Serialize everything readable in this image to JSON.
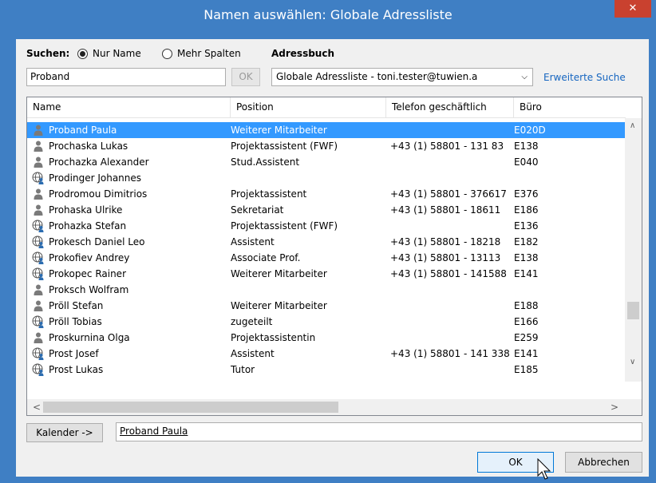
{
  "window": {
    "title": "Namen auswählen: Globale Adressliste",
    "close_glyph": "✕"
  },
  "search": {
    "label": "Suchen:",
    "radio_name_only": "Nur Name",
    "radio_more_columns": "Mehr Spalten",
    "value": "Proband",
    "ok_label": "OK"
  },
  "addressbook": {
    "label": "Adressbuch",
    "selected": "Globale Adressliste - toni.tester@tuwien.a",
    "advanced_search": "Erweiterte Suche"
  },
  "columns": [
    "Name",
    "Position",
    "Telefon geschäftlich",
    "Büro"
  ],
  "rows": [
    {
      "icon": "person",
      "name": "Proband Paula",
      "position": "Weiterer Mitarbeiter",
      "phone": "",
      "office": "E020D",
      "selected": true
    },
    {
      "icon": "person",
      "name": "Prochaska Lukas",
      "position": "Projektassistent (FWF)",
      "phone": "+43 (1) 58801 - 131 83",
      "office": "E138"
    },
    {
      "icon": "person",
      "name": "Prochazka Alexander",
      "position": "Stud.Assistent",
      "phone": "",
      "office": "E040"
    },
    {
      "icon": "globe",
      "name": "Prodinger Johannes",
      "position": "",
      "phone": "",
      "office": ""
    },
    {
      "icon": "person",
      "name": "Prodromou Dimitrios",
      "position": "Projektassistent",
      "phone": "+43 (1) 58801 - 376617",
      "office": "E376"
    },
    {
      "icon": "person",
      "name": "Prohaska Ulrike",
      "position": "Sekretariat",
      "phone": "+43 (1) 58801 - 18611",
      "office": "E186"
    },
    {
      "icon": "globe",
      "name": "Prohazka Stefan",
      "position": "Projektassistent (FWF)",
      "phone": "",
      "office": "E136"
    },
    {
      "icon": "globe",
      "name": "Prokesch Daniel Leo",
      "position": "Assistent",
      "phone": "+43 (1) 58801 - 18218",
      "office": "E182"
    },
    {
      "icon": "globe",
      "name": "Prokofiev Andrey",
      "position": "Associate Prof.",
      "phone": "+43 (1) 58801 - 13113",
      "office": "E138"
    },
    {
      "icon": "globe",
      "name": "Prokopec Rainer",
      "position": "Weiterer Mitarbeiter",
      "phone": "+43 (1) 58801 - 141588",
      "office": "E141"
    },
    {
      "icon": "person",
      "name": "Proksch Wolfram",
      "position": "",
      "phone": "",
      "office": ""
    },
    {
      "icon": "person",
      "name": "Pröll Stefan",
      "position": "Weiterer Mitarbeiter",
      "phone": "",
      "office": "E188"
    },
    {
      "icon": "globe",
      "name": "Pröll Tobias",
      "position": "zugeteilt",
      "phone": "",
      "office": "E166"
    },
    {
      "icon": "person",
      "name": "Proskurnina Olga",
      "position": "Projektassistentin",
      "phone": "",
      "office": "E259"
    },
    {
      "icon": "globe",
      "name": "Prost Josef",
      "position": "Assistent",
      "phone": "+43 (1) 58801 - 141 338",
      "office": "E141"
    },
    {
      "icon": "globe",
      "name": "Prost Lukas",
      "position": "Tutor",
      "phone": "",
      "office": "E185"
    }
  ],
  "scroll": {
    "up_glyph": "∧",
    "down_glyph": "∨",
    "left_glyph": "<",
    "right_glyph": ">"
  },
  "footer": {
    "calendar_button": "Kalender ->",
    "selected_name": "Proband Paula",
    "ok": "OK",
    "cancel": "Abbrechen"
  },
  "colors": {
    "title_bar": "#3f7fc4",
    "selection": "#3399ff",
    "close": "#c9412f"
  }
}
